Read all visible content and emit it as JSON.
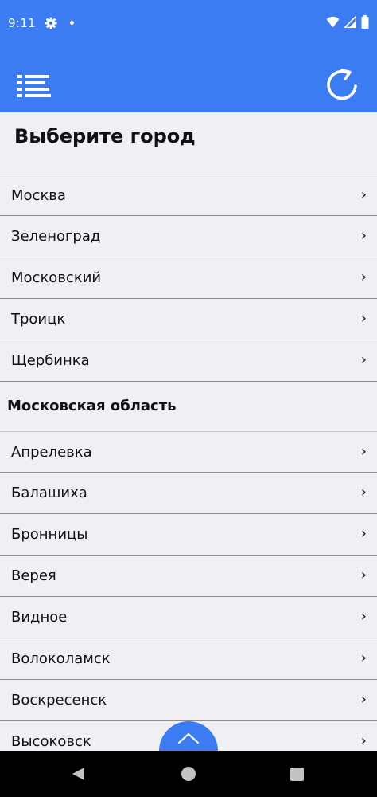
{
  "status_bar": {
    "time": "9:11",
    "icons": [
      "settings-icon",
      "notification-dot",
      "wifi-icon",
      "signal-icon",
      "battery-icon"
    ]
  },
  "app_bar": {
    "background": "#3b7cf3",
    "menu_icon": "menu-list-icon",
    "refresh_icon": "refresh-icon"
  },
  "page": {
    "title": "Выберите город"
  },
  "cities": [
    {
      "name": "Москва"
    },
    {
      "name": "Зеленоград"
    },
    {
      "name": "Московский"
    },
    {
      "name": "Троицк"
    },
    {
      "name": "Щербинка"
    }
  ],
  "region": {
    "title": "Московская область",
    "items": [
      {
        "name": "Апрелевка"
      },
      {
        "name": "Балашиха"
      },
      {
        "name": "Бронницы"
      },
      {
        "name": "Верея"
      },
      {
        "name": "Видное"
      },
      {
        "name": "Волоколамск"
      },
      {
        "name": "Воскресенск"
      },
      {
        "name": "Высоковск"
      }
    ]
  },
  "chevron": "›",
  "scroll_top_icon": "chevron-up-icon",
  "nav_bar": {
    "buttons": [
      "back-icon",
      "home-icon",
      "recents-icon"
    ]
  }
}
